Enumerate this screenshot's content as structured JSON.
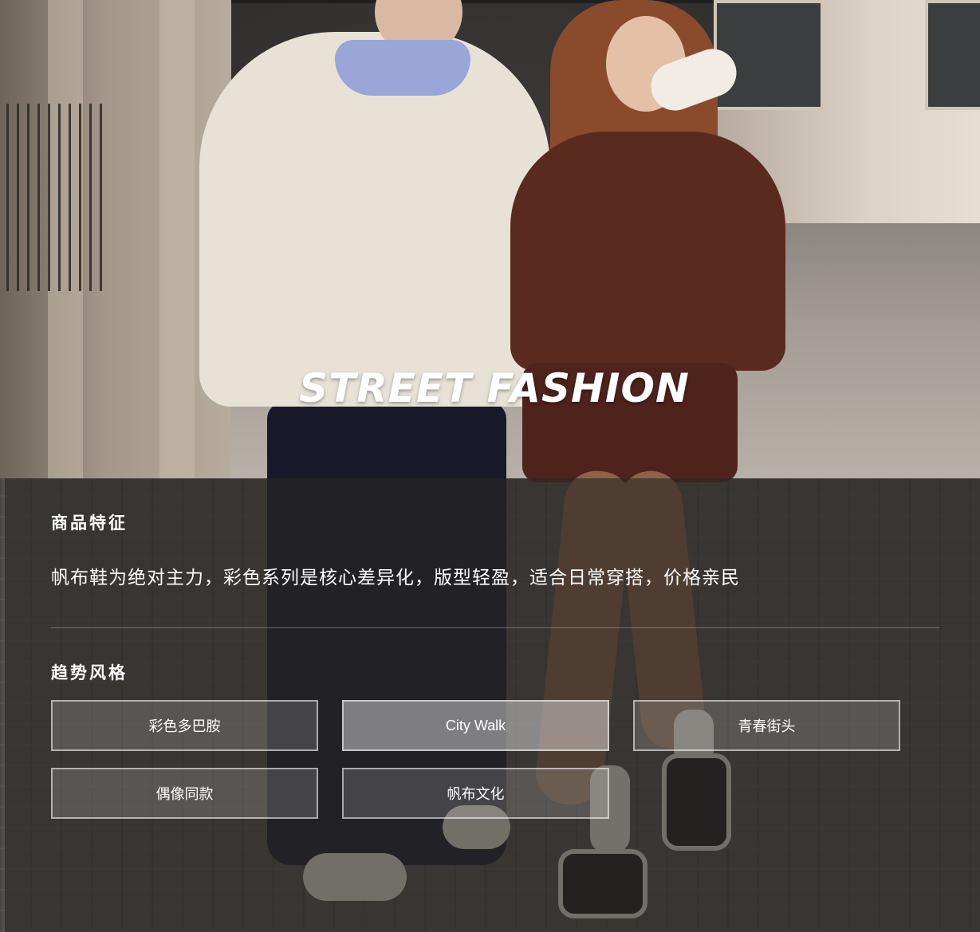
{
  "hero": {
    "logo_text": "STREET FASHION"
  },
  "features": {
    "title": "商品特征",
    "description": "帆布鞋为绝对主力，彩色系列是核心差异化，版型轻盈，适合日常穿搭，价格亲民"
  },
  "trends": {
    "title": "趋势风格",
    "tags": [
      "彩色多巴胺",
      "City Walk",
      "青春街头",
      "偶像同款",
      "帆布文化"
    ],
    "active_tag": "City Walk"
  }
}
